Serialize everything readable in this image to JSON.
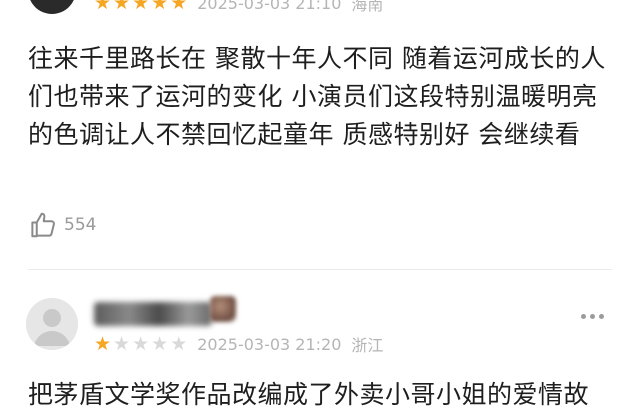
{
  "reviews": [
    {
      "rating": 5,
      "date": "2025-03-03 21:10",
      "location": "海南",
      "content": "往来千里路长在 聚散十年人不同 随着运河成长的人们也带来了运河的变化 小演员们这段特别温暖明亮的色调让人不禁回忆起童年 质感特别好 会继续看",
      "likes": "554"
    },
    {
      "rating": 1,
      "date": "2025-03-03 21:20",
      "location": "浙江",
      "content": "把茅盾文学奖作品改编成了外卖小哥小姐的爱情故"
    }
  ],
  "colors": {
    "star_on": "#f5a623",
    "star_off": "#d9d9d9",
    "meta_text": "#b5b5b5"
  },
  "icons": {
    "like": "thumbs-up-icon",
    "more": "more-dots-icon",
    "avatar": "default-avatar-icon"
  }
}
